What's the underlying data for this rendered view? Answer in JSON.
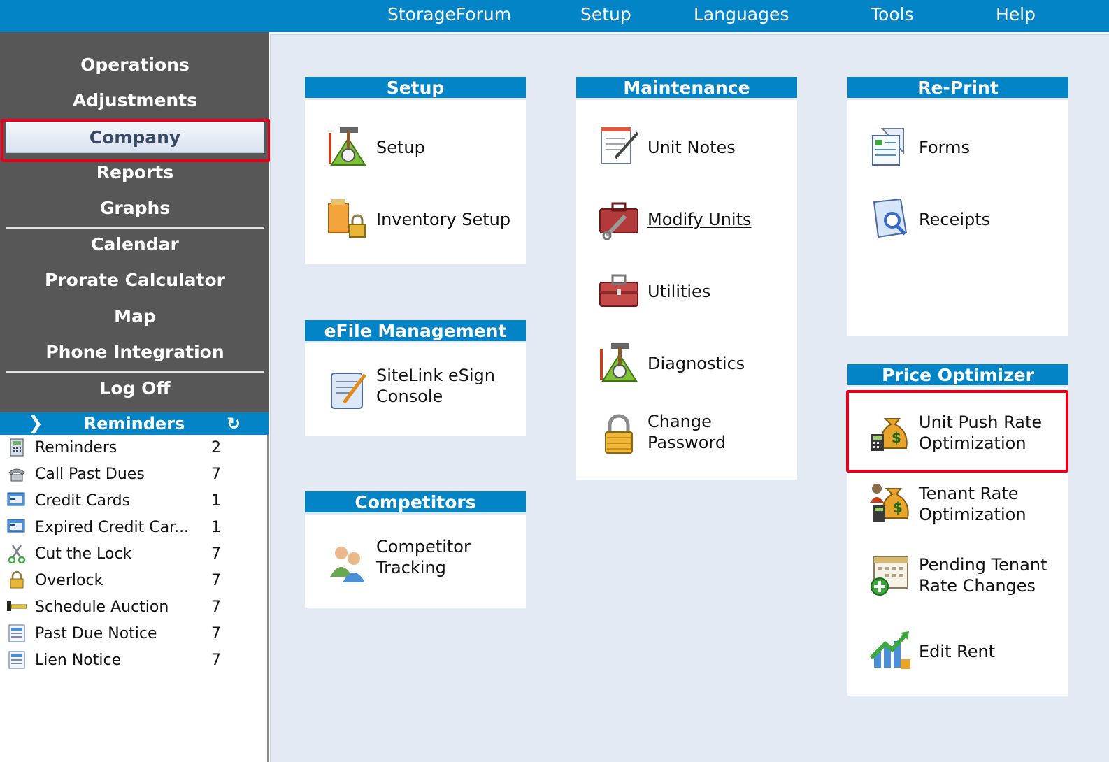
{
  "topbar": {
    "items": [
      "StorageForum",
      "Setup",
      "Languages",
      "Tools",
      "Help"
    ]
  },
  "sidebar": {
    "items": [
      "Operations",
      "Adjustments",
      "Company",
      "Reports",
      "Graphs",
      "Calendar",
      "Prorate Calculator",
      "Map",
      "Phone Integration",
      "Log Off"
    ],
    "active": "Company"
  },
  "reminders": {
    "header": "Reminders",
    "rows": [
      {
        "label": "Reminders",
        "count": "2",
        "icon": "calculator-icon"
      },
      {
        "label": "Call Past Dues",
        "count": "7",
        "icon": "telephone-icon"
      },
      {
        "label": "Credit Cards",
        "count": "1",
        "icon": "credit-card-icon"
      },
      {
        "label": "Expired Credit Car...",
        "count": "1",
        "icon": "credit-card-icon"
      },
      {
        "label": "Cut the Lock",
        "count": "7",
        "icon": "scissors-icon"
      },
      {
        "label": "Overlock",
        "count": "7",
        "icon": "padlock-icon"
      },
      {
        "label": "Schedule Auction",
        "count": "7",
        "icon": "gavel-icon"
      },
      {
        "label": "Past Due Notice",
        "count": "7",
        "icon": "notice-icon"
      },
      {
        "label": "Lien Notice",
        "count": "7",
        "icon": "notice-icon"
      }
    ]
  },
  "cards": {
    "setup": {
      "title": "Setup",
      "items": [
        "Setup",
        "Inventory Setup"
      ]
    },
    "efile": {
      "title": "eFile Management",
      "items": [
        [
          "SiteLink eSign",
          "Console"
        ]
      ]
    },
    "competitors": {
      "title": "Competitors",
      "items": [
        [
          "Competitor",
          "Tracking"
        ]
      ]
    },
    "maintenance": {
      "title": "Maintenance",
      "items": [
        "Unit Notes",
        "Modify Units",
        "Utilities",
        "Diagnostics",
        [
          "Change",
          "Password"
        ]
      ]
    },
    "reprint": {
      "title": "Re-Print",
      "items": [
        "Forms",
        "Receipts"
      ]
    },
    "price": {
      "title": "Price Optimizer",
      "items": [
        [
          "Unit Push Rate",
          "Optimization"
        ],
        [
          "Tenant Rate",
          "Optimization"
        ],
        [
          "Pending Tenant",
          "Rate Changes"
        ],
        "Edit Rent"
      ]
    }
  },
  "colors": {
    "accent": "#0384c6",
    "sidebar": "#575757",
    "highlight": "#e5001b",
    "content_bg": "#e4eaf3"
  }
}
